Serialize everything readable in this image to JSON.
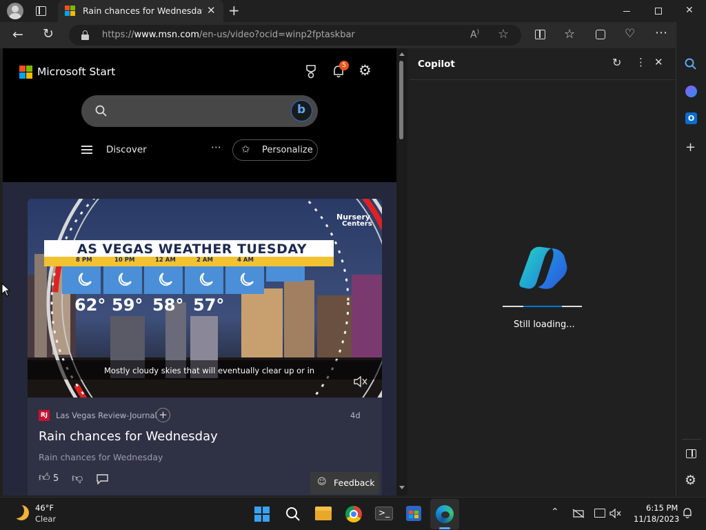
{
  "tab": {
    "title": "Rain chances for Wednesday | W"
  },
  "address": {
    "prefix": "https://",
    "domain": "www.msn.com",
    "path": "/en-us/video?ocid=winp2fptaskbar"
  },
  "msn": {
    "brand": "Microsoft Start",
    "notification_count": "5",
    "search_placeholder": "",
    "discover_label": "Discover",
    "personalize_label": "Personalize"
  },
  "video": {
    "banner": "AS VEGAS WEATHER TUESDAY",
    "logo_line1": "Nursery",
    "logo_line2": "Centers",
    "times": [
      "8 PM",
      "10 PM",
      "12 AM",
      "2 AM",
      "4 AM"
    ],
    "temps": [
      "62°",
      "59°",
      "58°",
      "57°"
    ],
    "caption": "Mostly cloudy skies that will eventually clear up or in"
  },
  "article": {
    "source_badge": "RJ",
    "source": "Las Vegas Review-Journal",
    "age": "4d",
    "title": "Rain chances for Wednesday",
    "subtitle": "Rain chances for Wednesday",
    "likes": "5",
    "feedback_label": "Feedback"
  },
  "copilot": {
    "title": "Copilot",
    "status": "Still loading..."
  },
  "weather": {
    "temp": "46°F",
    "cond": "Clear"
  },
  "clock": {
    "time": "6:15 PM",
    "date": "11/18/2023"
  },
  "colors": {
    "accent": "#0078d4",
    "badge": "#e8561c",
    "feed": "#24283a"
  }
}
